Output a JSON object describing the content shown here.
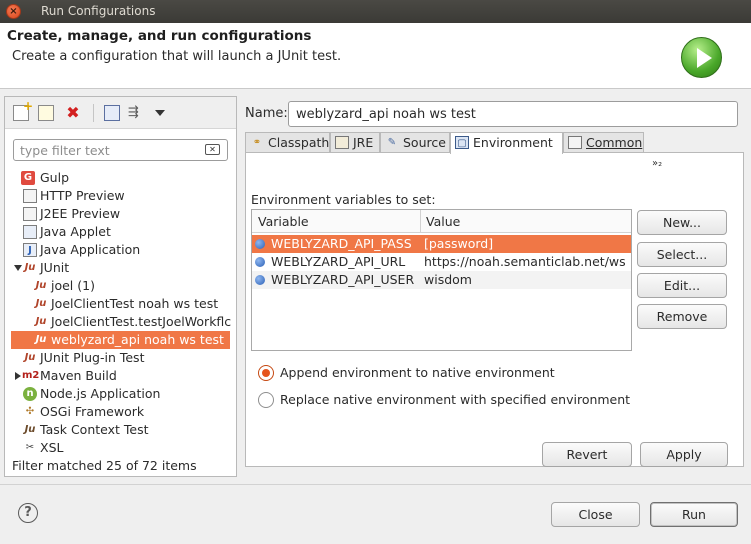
{
  "window": {
    "title": "Run Configurations"
  },
  "header": {
    "title": "Create, manage, and run configurations",
    "description": "Create a configuration that will launch a JUnit test."
  },
  "left": {
    "filter_placeholder": "type filter text",
    "tree": [
      {
        "label": "Gulp",
        "icon": "gulp-icon"
      },
      {
        "label": "HTTP Preview",
        "icon": "document-icon"
      },
      {
        "label": "J2EE Preview",
        "icon": "document-icon"
      },
      {
        "label": "Java Applet",
        "icon": "java-applet-icon"
      },
      {
        "label": "Java Application",
        "icon": "java-application-icon"
      },
      {
        "label": "JUnit",
        "icon": "junit-icon"
      },
      {
        "label": "joel (1)",
        "icon": "junit-icon"
      },
      {
        "label": "JoelClientTest noah ws test",
        "icon": "junit-icon"
      },
      {
        "label": "JoelClientTest.testJoelWorkflc",
        "icon": "junit-icon"
      },
      {
        "label": "weblyzard_api noah ws test",
        "icon": "junit-icon"
      },
      {
        "label": "JUnit Plug-in Test",
        "icon": "junit-plugin-icon"
      },
      {
        "label": "Maven Build",
        "icon": "maven-icon"
      },
      {
        "label": "Node.js Application",
        "icon": "nodejs-icon"
      },
      {
        "label": "OSGi Framework",
        "icon": "osgi-icon"
      },
      {
        "label": "Task Context Test",
        "icon": "task-context-icon"
      },
      {
        "label": "XSL",
        "icon": "xsl-icon"
      }
    ],
    "status": "Filter matched 25 of 72 items"
  },
  "right": {
    "name_label": "Name:",
    "name_value": "weblyzard_api noah ws test",
    "tabs": [
      {
        "label": "Classpath",
        "icon": "classpath-icon"
      },
      {
        "label": "JRE",
        "icon": "jre-icon"
      },
      {
        "label": "Source",
        "icon": "source-icon"
      },
      {
        "label": "Environment",
        "icon": "environment-icon",
        "active": true
      },
      {
        "label": "Common",
        "icon": "common-icon"
      }
    ],
    "overflow_label": "»₂",
    "env_label": "Environment variables to set:",
    "columns": [
      "Variable",
      "Value"
    ],
    "rows": [
      {
        "variable": "WEBLYZARD_API_PASS",
        "value": "[password]",
        "selected": true
      },
      {
        "variable": "WEBLYZARD_API_URL",
        "value": "https://noah.semanticlab.net/ws"
      },
      {
        "variable": "WEBLYZARD_API_USER",
        "value": "wisdom"
      }
    ],
    "side_buttons": [
      "New...",
      "Select...",
      "Edit...",
      "Remove"
    ],
    "radio_append": "Append environment to native environment",
    "radio_replace": "Replace native environment with specified environment",
    "revert": "Revert",
    "apply": "Apply"
  },
  "footer": {
    "close": "Close",
    "run": "Run"
  },
  "colors": {
    "selection": "#f07746",
    "run_green": "#4aa82a"
  }
}
